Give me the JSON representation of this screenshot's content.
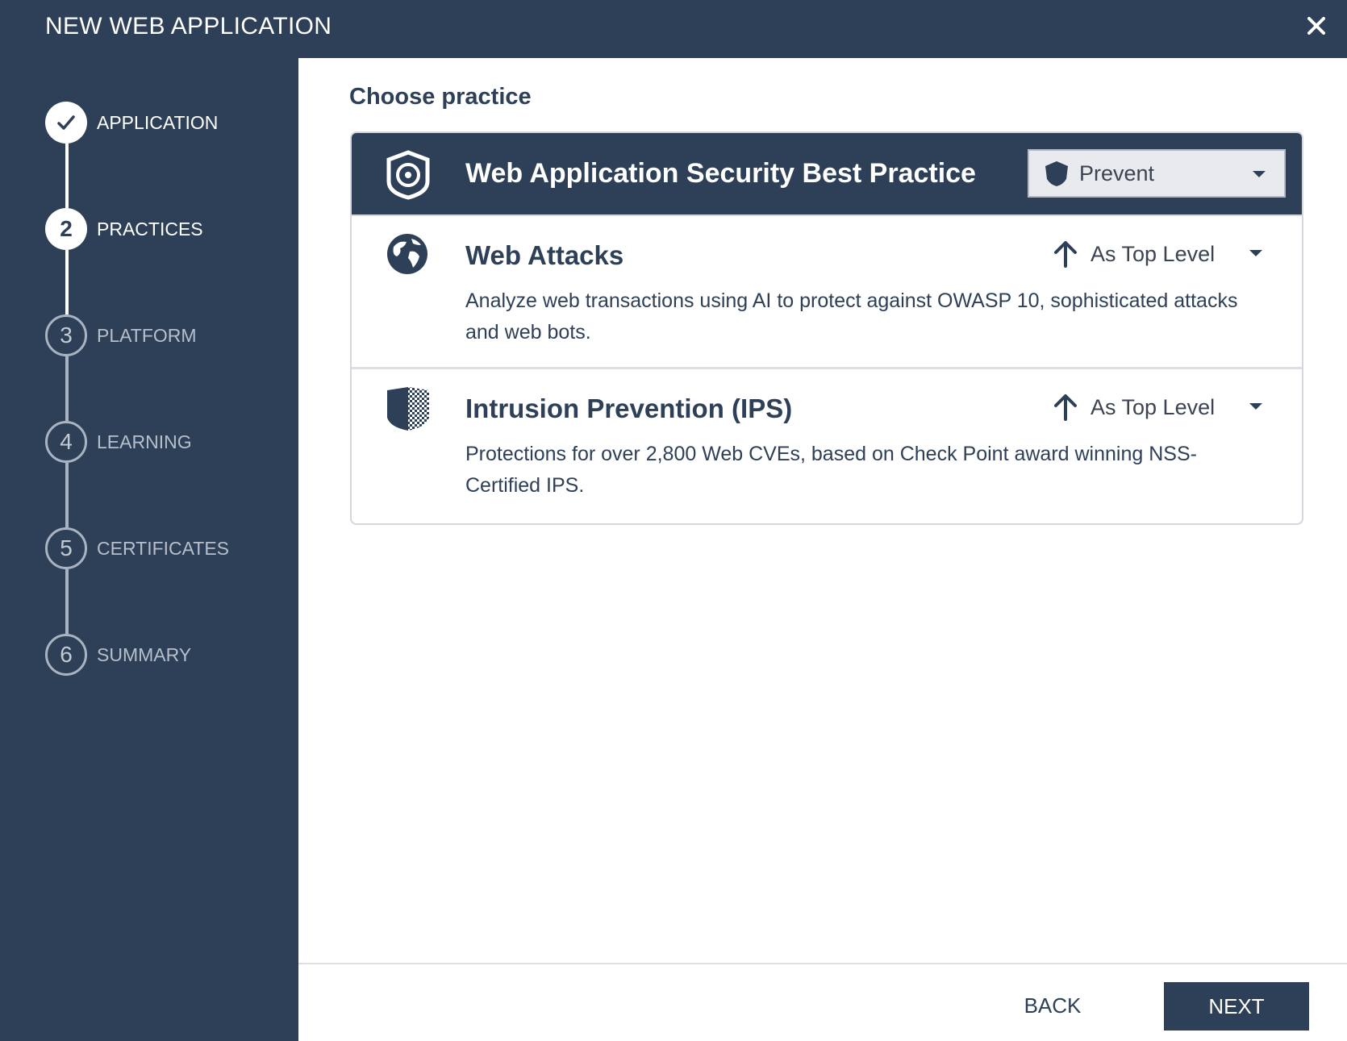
{
  "window": {
    "title": "NEW WEB APPLICATION",
    "close_icon": "close-icon"
  },
  "wizard": {
    "steps": [
      {
        "number": "1",
        "label": "APPLICATION",
        "state": "done"
      },
      {
        "number": "2",
        "label": "PRACTICES",
        "state": "current"
      },
      {
        "number": "3",
        "label": "PLATFORM",
        "state": "todo"
      },
      {
        "number": "4",
        "label": "LEARNING",
        "state": "todo"
      },
      {
        "number": "5",
        "label": "CERTIFICATES",
        "state": "todo"
      },
      {
        "number": "6",
        "label": "SUMMARY",
        "state": "todo"
      }
    ]
  },
  "main": {
    "heading": "Choose practice",
    "practice": {
      "title": "Web Application Security Best Practice",
      "icon": "shield-target-icon",
      "mode": "Prevent",
      "mode_icon": "shield-icon"
    },
    "sub_practices": [
      {
        "title": "Web Attacks",
        "icon": "globe-icon",
        "level": "As Top Level",
        "level_icon": "arrow-up-icon",
        "description": "Analyze web transactions using AI to protect against OWASP 10, sophisticated attacks and web bots."
      },
      {
        "title": "Intrusion Prevention (IPS)",
        "icon": "ips-shield-icon",
        "level": "As Top Level",
        "level_icon": "arrow-up-icon",
        "description": "Protections for over 2,800 Web CVEs, based on Check Point award winning NSS-Certified IPS."
      }
    ]
  },
  "footer": {
    "back_label": "BACK",
    "next_label": "NEXT"
  },
  "colors": {
    "primary": "#2e4058",
    "step_inactive": "#a9b3c1",
    "select_bg": "#e8eaee",
    "border": "#d4d8de"
  }
}
